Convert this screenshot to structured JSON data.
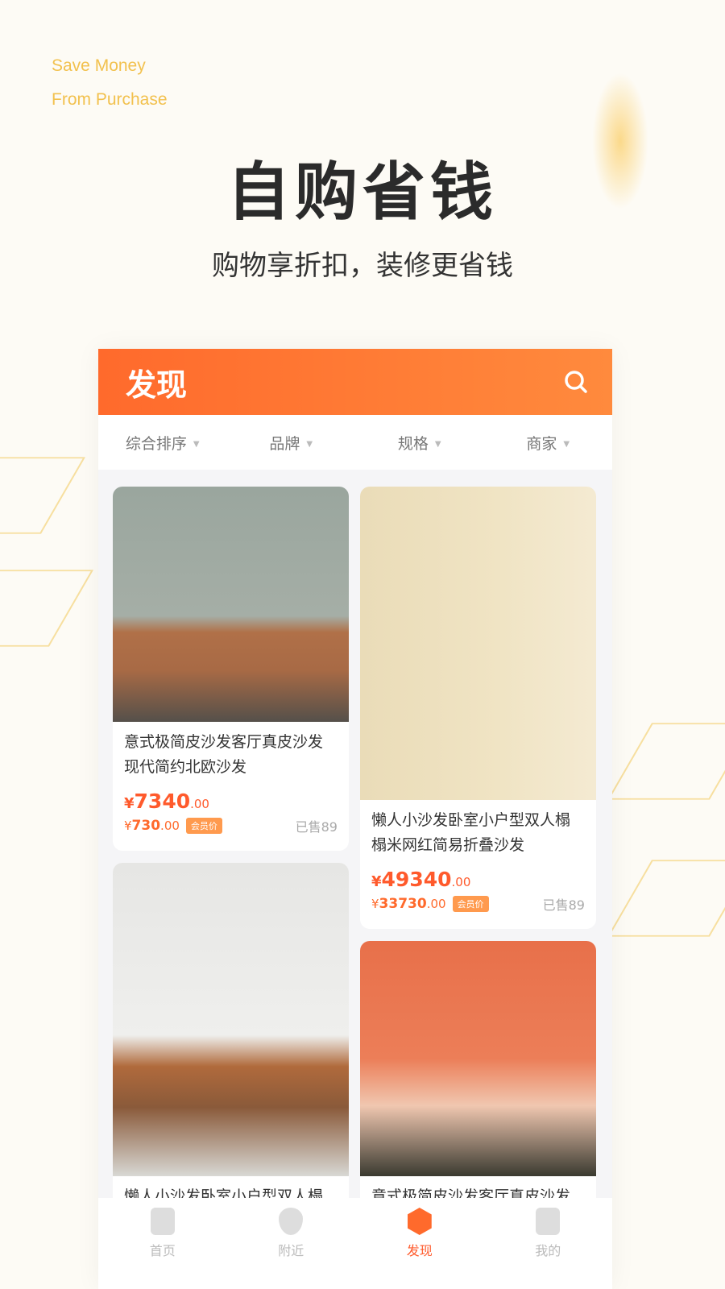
{
  "promo": {
    "en_line1": "Save Money",
    "en_line2": "From Purchase",
    "title": "自购省钱",
    "subtitle": "购物享折扣，装修更省钱"
  },
  "header": {
    "title": "发现",
    "search_icon": "search-icon"
  },
  "filters": [
    {
      "label": "综合排序"
    },
    {
      "label": "品牌"
    },
    {
      "label": "规格"
    },
    {
      "label": "商家"
    }
  ],
  "products": [
    {
      "name": "意式极简皮沙发客厅真皮沙发现代简约北欧沙发",
      "price": "7340",
      "price_dec": ".00",
      "member_price": "730",
      "member_dec": ".00",
      "badge": "会员价",
      "sold": "已售89"
    },
    {
      "name": "懒人小沙发卧室小户型双人榻榻米网红简易折叠沙发",
      "price": "49340",
      "price_dec": ".00",
      "member_price": "33730",
      "member_dec": ".00",
      "badge": "会员价",
      "sold": "已售89"
    },
    {
      "name": "懒人小沙发卧室小户型双人榻"
    },
    {
      "name": "意式极简皮沙发客厅真皮沙发"
    }
  ],
  "currency": "¥",
  "nav": [
    {
      "label": "首页"
    },
    {
      "label": "附近"
    },
    {
      "label": "发现"
    },
    {
      "label": "我的"
    }
  ],
  "colors": {
    "accent": "#ff6a2c",
    "promo_text": "#f2c14e"
  }
}
